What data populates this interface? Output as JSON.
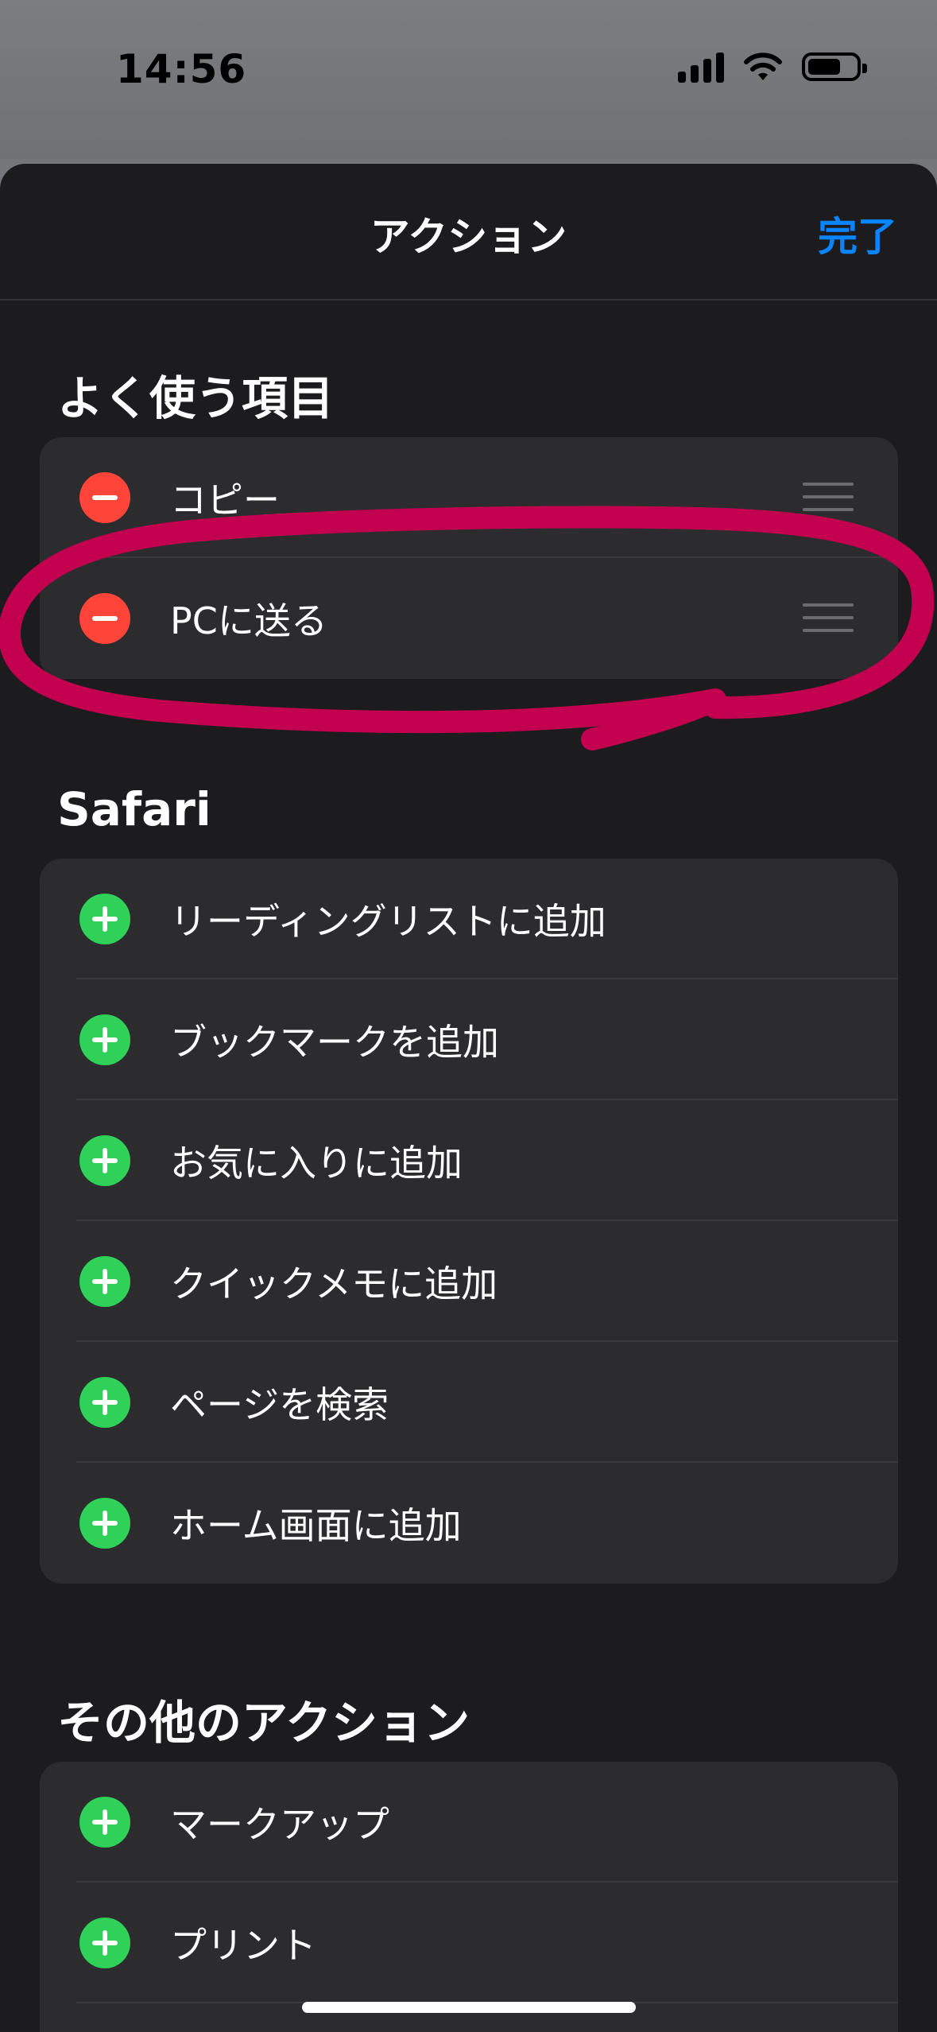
{
  "status_bar": {
    "time": "14:56"
  },
  "nav": {
    "title": "アクション",
    "done_label": "完了"
  },
  "favorites": {
    "title": "よく使う項目",
    "items": [
      {
        "label": "コピー"
      },
      {
        "label": "PCに送る"
      }
    ]
  },
  "safari": {
    "title": "Safari",
    "items": [
      {
        "label": "リーディングリストに追加"
      },
      {
        "label": "ブックマークを追加"
      },
      {
        "label": "お気に入りに追加"
      },
      {
        "label": "クイックメモに追加"
      },
      {
        "label": "ページを検索"
      },
      {
        "label": "ホーム画面に追加"
      }
    ]
  },
  "other": {
    "title": "その他のアクション",
    "items": [
      {
        "label": "マークアップ"
      },
      {
        "label": "プリント"
      }
    ]
  },
  "colors": {
    "accent": "#0a84ff",
    "remove": "#ff453a",
    "add": "#30d158",
    "annotation": "#c2004f"
  },
  "icons": [
    "minus-circle-icon",
    "plus-circle-icon",
    "drag-handle-icon",
    "signal-icon",
    "wifi-icon",
    "battery-icon"
  ]
}
